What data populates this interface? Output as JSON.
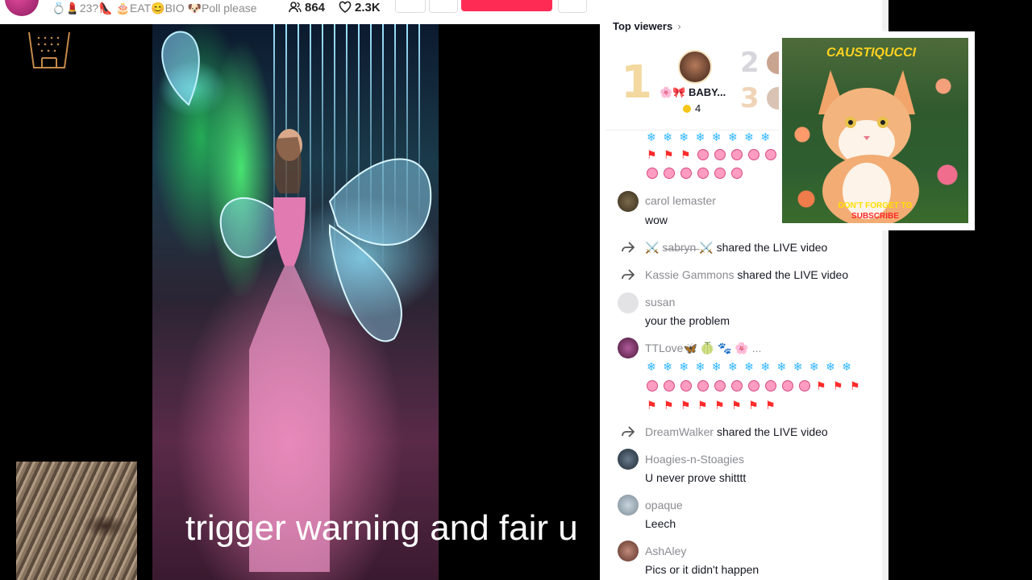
{
  "header": {
    "title": "💍💄23?👠 🎂EAT😊BIO 🐶Poll please",
    "viewers": "864",
    "likes": "2.3K"
  },
  "video": {
    "caption": "trigger warning and fair u"
  },
  "top_viewers": {
    "label": "Top viewers",
    "ranks": [
      "1",
      "2",
      "3"
    ],
    "first": {
      "name": "🌸🎀 BABY...",
      "coins": "4"
    }
  },
  "chat": [
    {
      "type": "emoji",
      "rows": [
        [
          "sf",
          "sf",
          "sf",
          "sf",
          "sf",
          "sf",
          "sf",
          "sf"
        ],
        [
          "fl",
          "fl",
          "fl",
          "fc",
          "fc",
          "fc",
          "fc",
          "fc",
          "fc"
        ],
        [
          "fc",
          "fc",
          "fc",
          "fc",
          "fc",
          "fc"
        ]
      ]
    },
    {
      "type": "comment",
      "user": "carol lemaster",
      "text": "wow"
    },
    {
      "type": "share",
      "user": "⚔️ s̶a̶b̶r̶y̶n̶ ⚔️",
      "text": "shared the LIVE video"
    },
    {
      "type": "share",
      "user": "Kassie Gammons",
      "text": "shared the LIVE video"
    },
    {
      "type": "comment",
      "user": "susan",
      "text": "your the problem"
    },
    {
      "type": "emoji-comment",
      "user": "TTLove🦋 🍈 🐾 🌸 ...",
      "rows": [
        [
          "sf",
          "sf",
          "sf",
          "sf",
          "sf",
          "sf",
          "sf",
          "sf",
          "sf",
          "sf",
          "sf",
          "sf",
          "sf"
        ],
        [
          "fc",
          "fc",
          "fc",
          "fc",
          "fc",
          "fc",
          "fc",
          "fc",
          "fc",
          "fc",
          "fl",
          "fl",
          "fl"
        ],
        [
          "fl",
          "fl",
          "fl",
          "fl",
          "fl",
          "fl",
          "fl",
          "fl"
        ]
      ]
    },
    {
      "type": "share",
      "user": "DreamWalker",
      "text": "shared the LIVE video"
    },
    {
      "type": "comment",
      "user": "Hoagies-n-Stoagies",
      "text": "U never prove shitttt"
    },
    {
      "type": "comment",
      "user": "opaque",
      "text": "Leech"
    },
    {
      "type": "comment",
      "user": "AshAley",
      "text": "Pics or it didn't happen"
    }
  ],
  "cat_ad": {
    "title": "CAUSTIQUCCI",
    "line1": "DON'T FORGET TO",
    "line2": "SUBSCRIBE"
  },
  "colors": {
    "subscribe": "#fe2c55",
    "snowflake": "#2fb5ff",
    "flag": "#ff2b2b"
  },
  "icons": {
    "snowflake": "❄",
    "flag": "⚑"
  }
}
